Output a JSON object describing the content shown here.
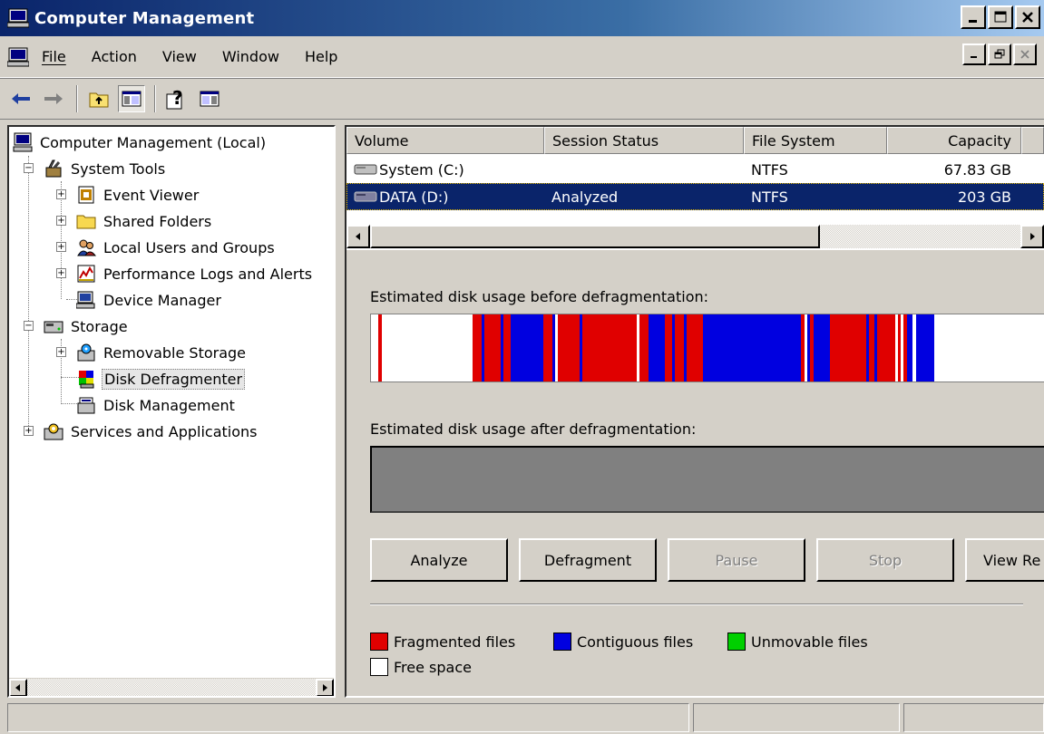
{
  "window": {
    "title": "Computer Management"
  },
  "menu": {
    "items": [
      "File",
      "Action",
      "View",
      "Window",
      "Help"
    ]
  },
  "toolbar": {
    "buttons": [
      "back-arrow-icon",
      "forward-arrow-icon",
      "up-folder-icon",
      "show-hide-tree-icon",
      "help-icon",
      "action-pane-icon"
    ]
  },
  "tree": {
    "nodes": [
      {
        "label": "Computer Management (Local)",
        "icon": "computer-icon"
      },
      {
        "label": "System Tools",
        "icon": "tools-icon"
      },
      {
        "label": "Event Viewer",
        "icon": "event-viewer-icon"
      },
      {
        "label": "Shared Folders",
        "icon": "folder-icon"
      },
      {
        "label": "Local Users and Groups",
        "icon": "users-icon"
      },
      {
        "label": "Performance Logs and Alerts",
        "icon": "performance-icon"
      },
      {
        "label": "Device Manager",
        "icon": "device-manager-icon"
      },
      {
        "label": "Storage",
        "icon": "storage-icon"
      },
      {
        "label": "Removable Storage",
        "icon": "removable-storage-icon"
      },
      {
        "label": "Disk Defragmenter",
        "icon": "defragmenter-icon"
      },
      {
        "label": "Disk Management",
        "icon": "disk-management-icon"
      },
      {
        "label": "Services and Applications",
        "icon": "services-icon"
      }
    ],
    "selected": "Disk Defragmenter"
  },
  "volumes": {
    "columns": [
      "Volume",
      "Session Status",
      "File System",
      "Capacity"
    ],
    "rows": [
      {
        "volume": "System (C:)",
        "status": "",
        "fs": "NTFS",
        "capacity": "67.83 GB",
        "selected": false
      },
      {
        "volume": "DATA (D:)",
        "status": "Analyzed",
        "fs": "NTFS",
        "capacity": "203 GB",
        "selected": true
      }
    ]
  },
  "defrag": {
    "before_label": "Estimated disk usage before defragmentation:",
    "after_label": "Estimated disk usage after defragmentation:",
    "buttons": [
      {
        "label": "Analyze",
        "enabled": true
      },
      {
        "label": "Defragment",
        "enabled": true
      },
      {
        "label": "Pause",
        "enabled": false
      },
      {
        "label": "Stop",
        "enabled": false
      },
      {
        "label": "View Re",
        "enabled": true
      }
    ],
    "legend": [
      {
        "label": "Fragmented files",
        "color": "#e00000"
      },
      {
        "label": "Contiguous files",
        "color": "#0000e0"
      },
      {
        "label": "Unmovable files",
        "color": "#00d000"
      },
      {
        "label": "Free space",
        "color": "#ffffff"
      }
    ],
    "colors": {
      "fragmented": "#e00000",
      "contiguous": "#0000e0",
      "free": "#ffffff"
    }
  }
}
